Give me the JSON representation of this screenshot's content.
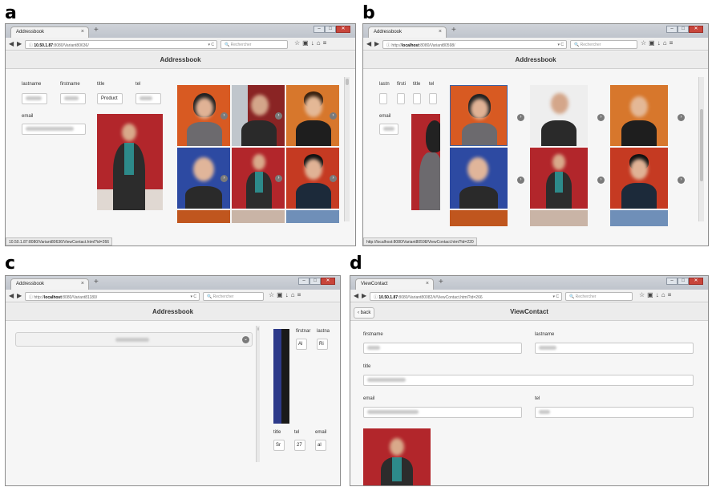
{
  "panels": {
    "a": {
      "label": "a",
      "tab_title": "Addressbook",
      "url_host": "10.50.1.87",
      "url_rest": ":8080/Variant80636/",
      "search_placeholder": "Rechercher",
      "page_title": "Addressbook",
      "labels": {
        "lastname": "lastname",
        "firstname": "firstname",
        "title": "title",
        "tel": "tel",
        "email": "email"
      },
      "values": {
        "title": "Product"
      },
      "status_url": "10.50.1.87:8080/Variant80636/ViewContact.html?id=266"
    },
    "b": {
      "label": "b",
      "tab_title": "Addressbook",
      "url_prefix": "http://",
      "url_host": "localhost",
      "url_rest": ":8080/Variant80598/",
      "search_placeholder": "Rechercher",
      "page_title": "Addressbook",
      "labels": {
        "lastname": "lastn",
        "firstname": "firsti",
        "title": "title",
        "tel": "tel",
        "email": "email"
      },
      "status_url": "http://localhost:8080/Variant80598/ViewContact.html?id=220"
    },
    "c": {
      "label": "c",
      "tab_title": "Addressbook",
      "url_prefix": "http://",
      "url_host": "localhost",
      "url_rest": ":8080/Variant81180/",
      "search_placeholder": "Rechercher",
      "page_title": "Addressbook",
      "labels": {
        "firstname": "firstnar",
        "lastname": "lastna",
        "title": "title",
        "tel": "tel",
        "email": "email"
      },
      "values": {
        "firstname": "Al",
        "lastname": "Ri",
        "title": "Sr",
        "tel": "27",
        "email": "al"
      }
    },
    "d": {
      "label": "d",
      "tab_title": "ViewContact",
      "url_host": "10.50.1.87",
      "url_rest": ":8080/Variant80082/#/ViewContact.html?id=266",
      "search_placeholder": "Rechercher",
      "page_title": "ViewContact",
      "back_label": "back",
      "labels": {
        "firstname": "firstname",
        "lastname": "lastname",
        "title": "title",
        "email": "email",
        "tel": "tel"
      }
    }
  },
  "icons": {
    "new_tab": "+",
    "tab_close": "×",
    "nav_back": "◀",
    "nav_forward": "▶",
    "info": "ⓘ",
    "reload": "▾ C",
    "search": "🔍",
    "toolbar": "☆▣↓⌂≡",
    "toolbar_d": "☆▣↓⌂≡",
    "next_arrow": "›",
    "circle_arrow": "›",
    "chevron_down": "⌄",
    "min": "–",
    "max": "□",
    "close": "✕",
    "back_arrow": "‹"
  },
  "colors": {
    "tabbar": "#c6cad1",
    "header": "#ececec",
    "accent_blue": "#3c62a6",
    "photo_red": "#b2262b",
    "photo_orange": "#d85a22"
  }
}
